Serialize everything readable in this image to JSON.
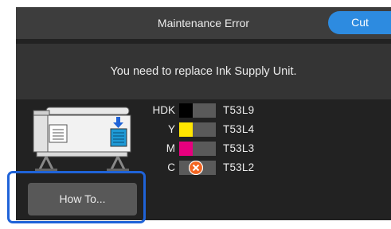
{
  "header": {
    "title": "Maintenance Error",
    "cut_label": "Cut"
  },
  "message": "You need to replace Ink Supply Unit.",
  "inks": [
    {
      "label": "HDK",
      "code": "T53L9",
      "color": "#000000",
      "error": false
    },
    {
      "label": "Y",
      "code": "T53L4",
      "color": "#ffe600",
      "error": false
    },
    {
      "label": "M",
      "code": "T53L3",
      "color": "#e6007e",
      "error": false
    },
    {
      "label": "C",
      "code": "T53L2",
      "color": "",
      "error": true
    }
  ],
  "howto_label": "How To...",
  "colors": {
    "accent": "#2d8be0",
    "highlight": "#1f63d8",
    "error": "#f26522",
    "background": "#222222"
  },
  "icons": {
    "printer": "printer-icon",
    "arrow": "arrow-down-icon",
    "error": "error-x-icon"
  }
}
